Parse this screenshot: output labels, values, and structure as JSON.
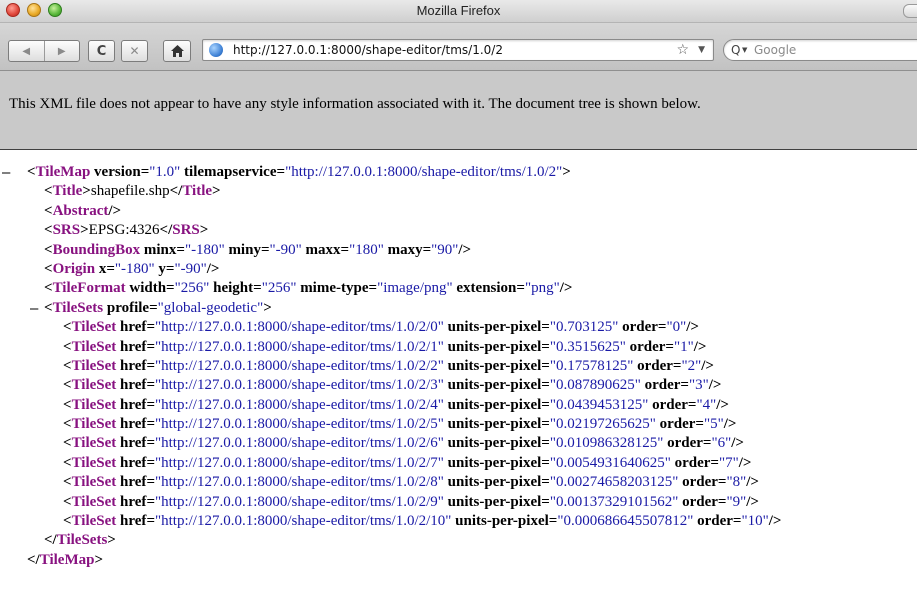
{
  "window": {
    "title": "Mozilla Firefox"
  },
  "toolbar": {
    "url": "http://127.0.0.1:8000/shape-editor/tms/1.0/2",
    "search_placeholder": "Google"
  },
  "notice": "This XML file does not appear to have any style information associated with it. The document tree is shown below.",
  "xml": {
    "tilemap_tag": "TileMap",
    "version_attr": "version",
    "version": "1.0",
    "tms_attr": "tilemapservice",
    "tilemapservice": "http://127.0.0.1:8000/shape-editor/tms/1.0/2",
    "title_tag": "Title",
    "title": "shapefile.shp",
    "abstract_tag": "Abstract",
    "srs_tag": "SRS",
    "srs": "EPSG:4326",
    "bbox_tag": "BoundingBox",
    "bbox": {
      "minx_attr": "minx",
      "minx": "-180",
      "miny_attr": "miny",
      "miny": "-90",
      "maxx_attr": "maxx",
      "maxx": "180",
      "maxy_attr": "maxy",
      "maxy": "90"
    },
    "origin_tag": "Origin",
    "origin": {
      "x_attr": "x",
      "x": "-180",
      "y_attr": "y",
      "y": "-90"
    },
    "tileformat_tag": "TileFormat",
    "tileformat": {
      "width_attr": "width",
      "width": "256",
      "height_attr": "height",
      "height": "256",
      "mime_attr": "mime-type",
      "mime": "image/png",
      "ext_attr": "extension",
      "ext": "png"
    },
    "tilesets_tag": "TileSets",
    "profile_attr": "profile",
    "profile": "global-geodetic",
    "tileset_tag": "TileSet",
    "href_attr": "href",
    "upp_attr": "units-per-pixel",
    "order_attr": "order",
    "tilesets": [
      {
        "href": "http://127.0.0.1:8000/shape-editor/tms/1.0/2/0",
        "upp": "0.703125",
        "order": "0"
      },
      {
        "href": "http://127.0.0.1:8000/shape-editor/tms/1.0/2/1",
        "upp": "0.3515625",
        "order": "1"
      },
      {
        "href": "http://127.0.0.1:8000/shape-editor/tms/1.0/2/2",
        "upp": "0.17578125",
        "order": "2"
      },
      {
        "href": "http://127.0.0.1:8000/shape-editor/tms/1.0/2/3",
        "upp": "0.087890625",
        "order": "3"
      },
      {
        "href": "http://127.0.0.1:8000/shape-editor/tms/1.0/2/4",
        "upp": "0.0439453125",
        "order": "4"
      },
      {
        "href": "http://127.0.0.1:8000/shape-editor/tms/1.0/2/5",
        "upp": "0.02197265625",
        "order": "5"
      },
      {
        "href": "http://127.0.0.1:8000/shape-editor/tms/1.0/2/6",
        "upp": "0.010986328125",
        "order": "6"
      },
      {
        "href": "http://127.0.0.1:8000/shape-editor/tms/1.0/2/7",
        "upp": "0.0054931640625",
        "order": "7"
      },
      {
        "href": "http://127.0.0.1:8000/shape-editor/tms/1.0/2/8",
        "upp": "0.00274658203125",
        "order": "8"
      },
      {
        "href": "http://127.0.0.1:8000/shape-editor/tms/1.0/2/9",
        "upp": "0.00137329101562",
        "order": "9"
      },
      {
        "href": "http://127.0.0.1:8000/shape-editor/tms/1.0/2/10",
        "upp": "0.000686645507812",
        "order": "10"
      }
    ]
  }
}
